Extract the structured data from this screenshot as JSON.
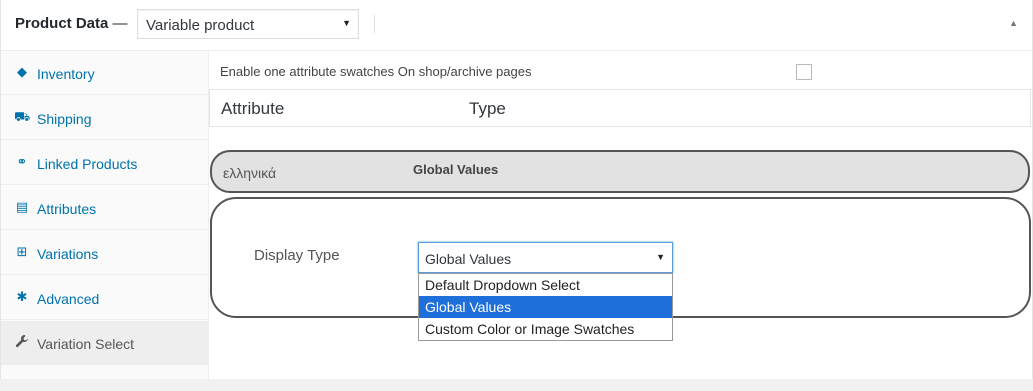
{
  "header": {
    "title": "Product Data",
    "dash": "—",
    "product_type": "Variable product",
    "select_arrow": "▼",
    "collapse_arrow": "▲"
  },
  "tabs": [
    {
      "label": "Inventory",
      "icon": "tag-icon",
      "glyph": "◆"
    },
    {
      "label": "Shipping",
      "icon": "truck-icon",
      "glyph": "⛟"
    },
    {
      "label": "Linked Products",
      "icon": "link-icon",
      "glyph": "⚭"
    },
    {
      "label": "Attributes",
      "icon": "list-icon",
      "glyph": "▤"
    },
    {
      "label": "Variations",
      "icon": "grid-icon",
      "glyph": "⊞"
    },
    {
      "label": "Advanced",
      "icon": "gear-icon",
      "glyph": "✱"
    },
    {
      "label": "Variation Select",
      "icon": "wrench-icon",
      "glyph": "🔧"
    }
  ],
  "content": {
    "enable_label": "Enable one attribute swatches On shop/archive pages",
    "table_headers": [
      "Attribute",
      "Type"
    ],
    "attribute": {
      "name": "ελληνικά",
      "type": "Global Values"
    },
    "display_type_label": "Display Type",
    "display_type_value": "Global Values",
    "select_arrow": "▼",
    "options": [
      "Default Dropdown Select",
      "Global Values",
      "Custom Color or Image Swatches"
    ],
    "selected_option": "Global Values"
  },
  "colors": {
    "link": "#0073aa",
    "selected_option_bg": "#1e6fd9"
  }
}
